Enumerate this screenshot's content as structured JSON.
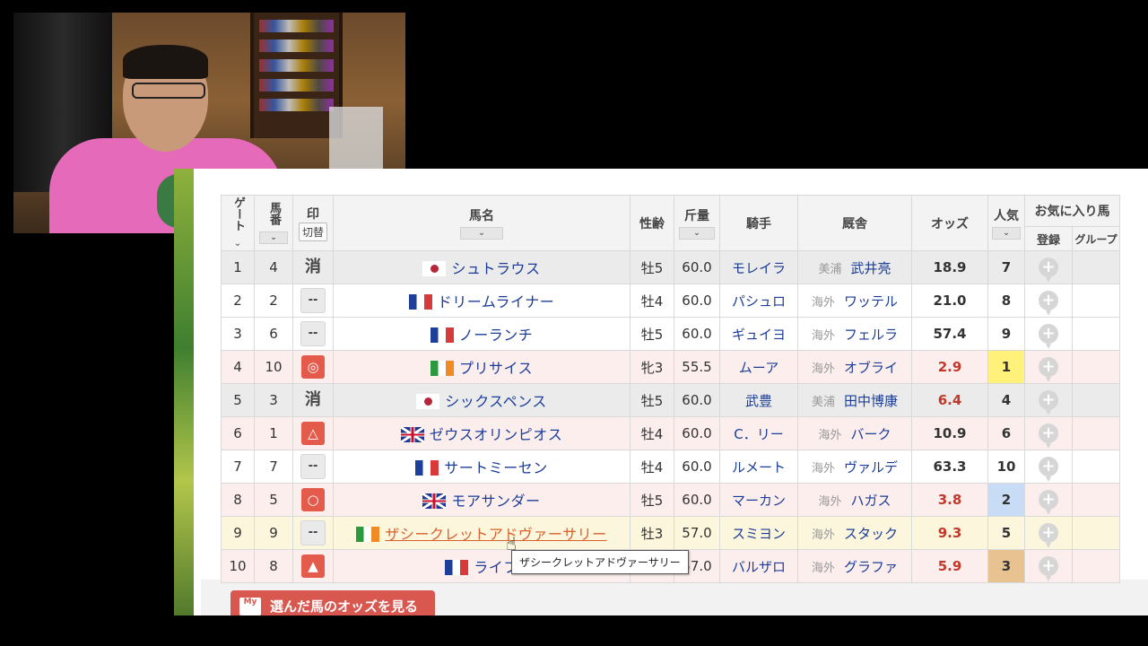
{
  "headers": {
    "gate": "ゲート",
    "number": "馬番",
    "mark": "印",
    "mark_toggle": "切替",
    "horse": "馬名",
    "sex_age": "性齢",
    "weight": "斤量",
    "jockey": "騎手",
    "stable": "厩舎",
    "odds": "オッズ",
    "popularity": "人気",
    "favorites": "お気に入り馬",
    "register": "登録",
    "group": "グループ"
  },
  "rows": [
    {
      "gate": "1",
      "num": "4",
      "mark": "消",
      "mark_style": "text",
      "flag": "jp",
      "horse": "シュトラウス",
      "sex_age": "牡5",
      "weight": "60.0",
      "jockey": "モレイラ",
      "region": "美浦",
      "trainer": "武井亮",
      "odds": "18.9",
      "odds_style": "lo",
      "pop": "7",
      "pop_style": "",
      "row_style": "grey"
    },
    {
      "gate": "2",
      "num": "2",
      "mark": "--",
      "mark_style": "grey",
      "flag": "fr",
      "horse": "ドリームライナー",
      "sex_age": "牡4",
      "weight": "60.0",
      "jockey": "パシュロ",
      "region": "海外",
      "trainer": "ワッテル",
      "odds": "21.0",
      "odds_style": "lo",
      "pop": "8",
      "pop_style": "",
      "row_style": "white"
    },
    {
      "gate": "3",
      "num": "6",
      "mark": "--",
      "mark_style": "grey",
      "flag": "fr",
      "horse": "ノーランチ",
      "sex_age": "牡5",
      "weight": "60.0",
      "jockey": "ギュイヨ",
      "region": "海外",
      "trainer": "フェルラ",
      "odds": "57.4",
      "odds_style": "lo",
      "pop": "9",
      "pop_style": "",
      "row_style": "white"
    },
    {
      "gate": "4",
      "num": "10",
      "mark": "◎",
      "mark_style": "red",
      "flag": "ie",
      "horse": "プリサイス",
      "sex_age": "牝3",
      "weight": "55.5",
      "jockey": "ムーア",
      "region": "海外",
      "trainer": "オブライ",
      "odds": "2.9",
      "odds_style": "hi",
      "pop": "1",
      "pop_style": "pop1",
      "row_style": "pink"
    },
    {
      "gate": "5",
      "num": "3",
      "mark": "消",
      "mark_style": "text",
      "flag": "jp",
      "horse": "シックスペンス",
      "sex_age": "牡5",
      "weight": "60.0",
      "jockey": "武豊",
      "region": "美浦",
      "trainer": "田中博康",
      "odds": "6.4",
      "odds_style": "hi",
      "pop": "4",
      "pop_style": "",
      "row_style": "grey"
    },
    {
      "gate": "6",
      "num": "1",
      "mark": "△",
      "mark_style": "red",
      "flag": "gb",
      "horse": "ゼウスオリンピオス",
      "sex_age": "牡4",
      "weight": "60.0",
      "jockey": "C．リー",
      "region": "海外",
      "trainer": "バーク",
      "odds": "10.9",
      "odds_style": "lo",
      "pop": "6",
      "pop_style": "",
      "row_style": "pink"
    },
    {
      "gate": "7",
      "num": "7",
      "mark": "--",
      "mark_style": "grey",
      "flag": "fr",
      "horse": "サートミーセン",
      "sex_age": "牡4",
      "weight": "60.0",
      "jockey": "ルメート",
      "region": "海外",
      "trainer": "ヴァルデ",
      "odds": "63.3",
      "odds_style": "lo",
      "pop": "10",
      "pop_style": "",
      "row_style": "white"
    },
    {
      "gate": "8",
      "num": "5",
      "mark": "○",
      "mark_style": "red",
      "flag": "gb",
      "horse": "モアサンダー",
      "sex_age": "牡5",
      "weight": "60.0",
      "jockey": "マーカン",
      "region": "海外",
      "trainer": "ハガス",
      "odds": "3.8",
      "odds_style": "hi",
      "pop": "2",
      "pop_style": "pop2",
      "row_style": "pink"
    },
    {
      "gate": "9",
      "num": "9",
      "mark": "--",
      "mark_style": "grey",
      "flag": "ie",
      "horse": "ザシークレットアドヴァーサリー",
      "sex_age": "牡3",
      "weight": "57.0",
      "jockey": "スミヨン",
      "region": "海外",
      "trainer": "スタック",
      "odds": "9.3",
      "odds_style": "hi",
      "pop": "5",
      "pop_style": "",
      "row_style": "yellow",
      "hover": true
    },
    {
      "gate": "10",
      "num": "8",
      "mark": "▲",
      "mark_style": "red",
      "flag": "fr",
      "horse": "ライフ",
      "sex_age": "",
      "weight": "57.0",
      "jockey": "バルザロ",
      "region": "海外",
      "trainer": "グラファ",
      "odds": "5.9",
      "odds_style": "hi",
      "pop": "3",
      "pop_style": "pop3",
      "row_style": "pink"
    }
  ],
  "tooltip": "ザシークレットアドヴァーサリー",
  "odds_button": "選んだ馬のオッズを見る",
  "odds_button_icon": "My",
  "plus_glyph": "+",
  "sort_glyph": "⌄"
}
